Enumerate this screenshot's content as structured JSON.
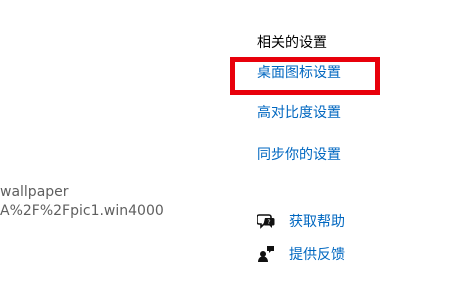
{
  "left_panel": {
    "text_line1": "wallpaper",
    "text_line2": "A%2F%2Fpic1.win4000"
  },
  "related_settings": {
    "title": "相关的设置",
    "desktop_icon_settings": "桌面图标设置",
    "high_contrast_settings": "高对比度设置",
    "sync_settings": "同步你的设置"
  },
  "help": {
    "get_help": "获取帮助",
    "give_feedback": "提供反馈"
  },
  "colors": {
    "link": "#0067c0",
    "highlight": "#e8000b"
  },
  "icons": {
    "get_help": "chat-help-icon",
    "give_feedback": "feedback-icon"
  }
}
